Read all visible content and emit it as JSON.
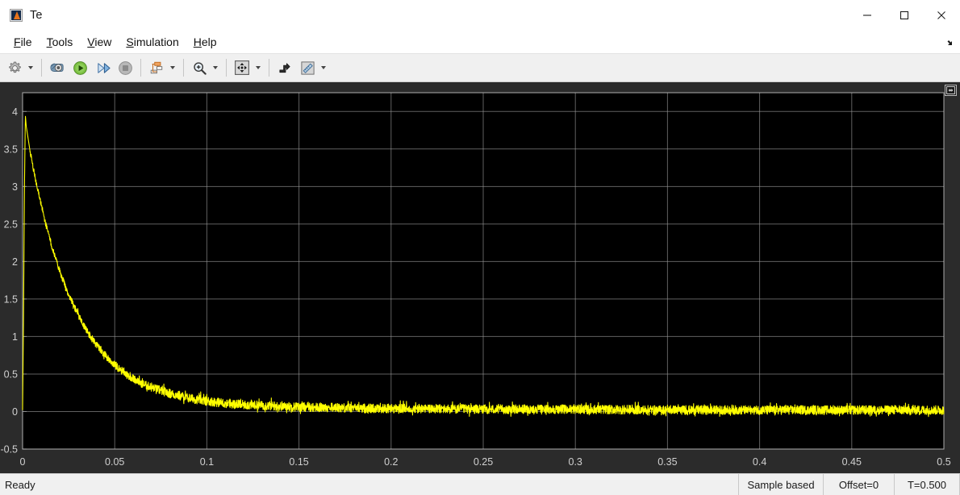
{
  "window": {
    "title": "Te",
    "icon": "simulink-scope-icon",
    "controls": [
      {
        "name": "minimize-button",
        "glyph": "minimize-icon"
      },
      {
        "name": "maximize-button",
        "glyph": "maximize-icon"
      },
      {
        "name": "close-button",
        "glyph": "close-icon"
      }
    ]
  },
  "menubar": {
    "items": [
      {
        "label": "File",
        "mnemonic": "F",
        "rest": "ile"
      },
      {
        "label": "Tools",
        "mnemonic": "T",
        "rest": "ools"
      },
      {
        "label": "View",
        "mnemonic": "V",
        "rest": "iew"
      },
      {
        "label": "Simulation",
        "mnemonic": "S",
        "rest": "imulation"
      },
      {
        "label": "Help",
        "mnemonic": "H",
        "rest": "elp"
      }
    ],
    "expand_icon": "expand-arrow-icon"
  },
  "toolbar": {
    "buttons": [
      {
        "name": "configuration-properties-button",
        "icon": "gear-icon",
        "has_caret": true
      },
      {
        "name": "simulink-model-button",
        "icon": "model-view-icon",
        "has_caret": false
      },
      {
        "name": "run-button",
        "icon": "play-icon",
        "has_caret": false
      },
      {
        "name": "step-forward-button",
        "icon": "step-forward-icon",
        "has_caret": false
      },
      {
        "name": "stop-button",
        "icon": "stop-icon",
        "has_caret": false
      },
      {
        "name": "signal-selection-button",
        "icon": "signal-hierarchy-icon",
        "has_caret": true
      },
      {
        "name": "zoom-in-button",
        "icon": "zoom-in-icon",
        "has_caret": true
      },
      {
        "name": "autoscale-button",
        "icon": "fit-to-view-icon",
        "has_caret": true
      },
      {
        "name": "trigger-button",
        "icon": "trigger-icon",
        "has_caret": false
      },
      {
        "name": "measurements-button",
        "icon": "ruler-icon",
        "has_caret": true
      }
    ]
  },
  "scope": {
    "corner_button": "maximize-axes-icon",
    "colors": {
      "background": "#000000",
      "panel": "#2b2b2b",
      "grid": "#9b9b9b",
      "axis_border": "#c8c8c8",
      "tick_label": "#d0d0d0",
      "signal": "#ffff00"
    }
  },
  "statusbar": {
    "ready_label": "Ready",
    "sample_mode": "Sample based",
    "offset": "Offset=0",
    "time": "T=0.500"
  },
  "chart_data": {
    "type": "line",
    "title": "Te",
    "xlabel": "",
    "ylabel": "",
    "xlim": [
      0,
      0.5
    ],
    "ylim": [
      -0.5,
      4.25
    ],
    "grid": true,
    "legend": "none",
    "xticks": [
      0,
      0.05,
      0.1,
      0.15,
      0.2,
      0.25,
      0.3,
      0.35,
      0.4,
      0.45,
      0.5
    ],
    "xtick_labels": [
      "0",
      "0.05",
      "0.1",
      "0.15",
      "0.2",
      "0.25",
      "0.3",
      "0.35",
      "0.4",
      "0.45",
      "0.5"
    ],
    "yticks": [
      -0.5,
      0,
      0.5,
      1,
      1.5,
      2,
      2.5,
      3,
      3.5,
      4
    ],
    "ytick_labels": [
      "-0.5",
      "0",
      "0.5",
      "1",
      "1.5",
      "2",
      "2.5",
      "3",
      "3.5",
      "4"
    ],
    "series": [
      {
        "name": "Te",
        "color": "#ffff00",
        "description": "Electromagnetic torque: steep rise to peak 3.95 at t=0.0015 then exponential decay with noise, settling near 0 after t=0.13",
        "peak_value": 3.95,
        "peak_time": 0.0015,
        "steady_state": 0.02,
        "decay_time_constant": 0.022,
        "noise_amplitude": 0.06,
        "x": [
          0,
          0.0005,
          0.001,
          0.0015,
          0.002,
          0.004,
          0.006,
          0.008,
          0.01,
          0.012,
          0.014,
          0.016,
          0.018,
          0.02,
          0.024,
          0.028,
          0.032,
          0.036,
          0.04,
          0.045,
          0.05,
          0.055,
          0.06,
          0.065,
          0.07,
          0.08,
          0.09,
          0.1,
          0.11,
          0.12,
          0.13,
          0.15,
          0.175,
          0.2,
          0.25,
          0.3,
          0.35,
          0.4,
          0.45,
          0.5
        ],
        "y": [
          0.02,
          1.25,
          2.95,
          3.95,
          3.8,
          3.48,
          3.22,
          2.98,
          2.76,
          2.55,
          2.37,
          2.2,
          2.03,
          1.88,
          1.62,
          1.4,
          1.2,
          1.03,
          0.89,
          0.74,
          0.62,
          0.52,
          0.44,
          0.37,
          0.32,
          0.24,
          0.18,
          0.14,
          0.11,
          0.09,
          0.08,
          0.06,
          0.05,
          0.04,
          0.03,
          0.03,
          0.02,
          0.02,
          0.02,
          0.02
        ]
      }
    ]
  }
}
